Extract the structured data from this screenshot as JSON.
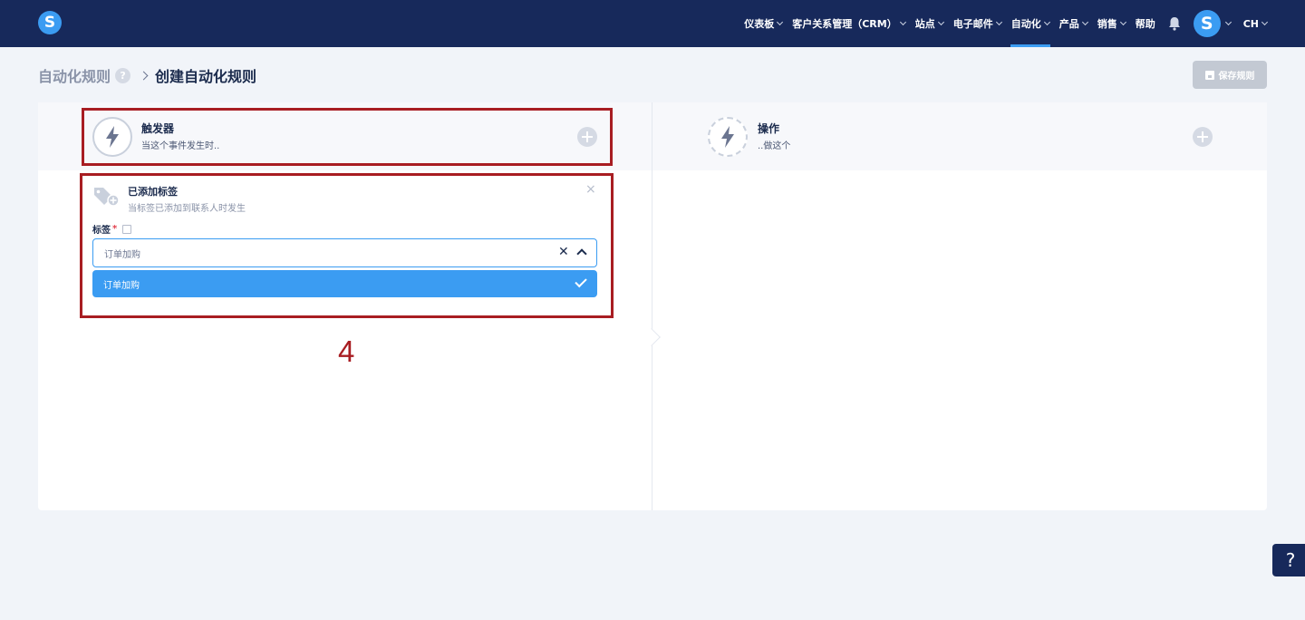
{
  "brand": {
    "logo_letter": "S"
  },
  "nav": {
    "items": [
      {
        "label": "仪表板",
        "has_menu": true,
        "active": false
      },
      {
        "label": "客户关系管理（CRM）",
        "has_menu": true,
        "active": false
      },
      {
        "label": "站点",
        "has_menu": true,
        "active": false
      },
      {
        "label": "电子邮件",
        "has_menu": true,
        "active": false
      },
      {
        "label": "自动化",
        "has_menu": true,
        "active": true
      },
      {
        "label": "产品",
        "has_menu": true,
        "active": false
      },
      {
        "label": "销售",
        "has_menu": true,
        "active": false
      },
      {
        "label": "帮助",
        "has_menu": false,
        "active": false
      }
    ],
    "avatar_letter": "S",
    "language": "CH"
  },
  "breadcrumb": {
    "root": "自动化规则",
    "help": "?",
    "current": "创建自动化规则"
  },
  "save_button": {
    "label": "保存规则"
  },
  "trigger": {
    "title": "触发器",
    "subtitle": "当这个事件发生时.."
  },
  "action": {
    "title": "操作",
    "subtitle": "..做这个"
  },
  "trigger_detail": {
    "title": "已添加标签",
    "subtitle": "当标签已添加到联系人时发生",
    "close": "×",
    "field_label": "标签",
    "required_mark": "*",
    "selected_value": "订单加购",
    "clear": "✕",
    "options": [
      {
        "label": "订单加购",
        "selected": true
      }
    ]
  },
  "annotation": {
    "number": "4"
  },
  "help_fab": {
    "label": "?"
  },
  "colors": {
    "navbar": "#17295b",
    "accent": "#3b9cf2",
    "annotation_red": "#a81d22"
  }
}
